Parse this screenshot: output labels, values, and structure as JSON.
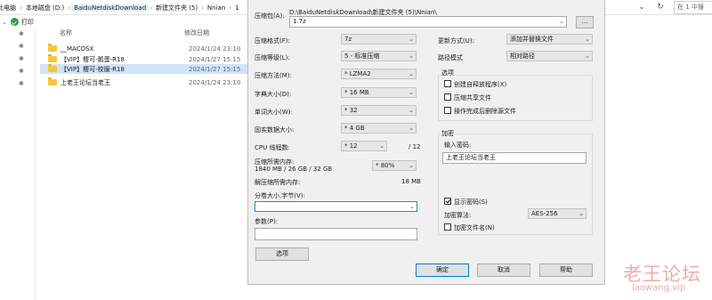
{
  "explorer": {
    "breadcrumb": [
      "此电脑",
      "本地磁盘 (D:)",
      "BaiduNetdiskDownload",
      "新建文件夹 (5)",
      "Nnian",
      "1"
    ],
    "search_placeholder": "在 1 中搜",
    "toolbar_label": "打印",
    "columns": {
      "name": "名称",
      "date": "修改日期"
    },
    "files": [
      {
        "name": "__MACOSX",
        "date": "2024/1/24 23:10",
        "selected": false
      },
      {
        "name": "【VIP】樱可-鹅蛋-R18",
        "date": "2024/1/27 15:15",
        "selected": false
      },
      {
        "name": "【VIP】樱可-校服-R18",
        "date": "2024/1/27 15:15",
        "selected": true
      },
      {
        "name": "上老王论坛当老王",
        "date": "2024/1/24 23:10",
        "selected": false
      }
    ]
  },
  "dialog": {
    "archive_label": "压缩包(A):",
    "archive_path": "D:\\BaiduNetdiskDownload\\新建文件夹 (5)\\Nnian\\",
    "archive_name": "1.7z",
    "browse_label": "...",
    "format_label": "压缩格式(F):",
    "format_value": "7z",
    "level_label": "压缩等级(L):",
    "level_value": "5 - 标准压缩",
    "method_label": "压缩方法(M):",
    "method_value": "* LZMA2",
    "dict_label": "字典大小(D):",
    "dict_value": "* 16 MB",
    "word_label": "单词大小(W):",
    "word_value": "* 32",
    "solid_label": "固实数据大小:",
    "solid_value": "* 4 GB",
    "threads_label": "CPU 线程数:",
    "threads_value": "* 12",
    "threads_max": "/ 12",
    "mem_label": "压缩所需内存:",
    "mem_detail": "1840 MB / 26 GB / 32 GB",
    "mem_value": "* 80%",
    "decomp_label": "解压缩所需内存:",
    "decomp_value": "18 MB",
    "split_label": "分卷大小,字节(V):",
    "split_value": "",
    "params_label": "参数(P):",
    "params_value": "",
    "options_button": "选项",
    "update_label": "更新方式(U):",
    "update_value": "添加并替换文件",
    "pathmode_label": "路径模式",
    "pathmode_value": "相对路径",
    "options_group": "选项",
    "opt_sfx": "创建自释放程序(X)",
    "opt_shared": "压缩共享文件",
    "opt_delete": "操作完成后删除源文件",
    "encrypt_group": "加密",
    "password_label": "输入密码:",
    "password_value": "上老王论坛当老王",
    "show_password": "显示密码(S)",
    "enc_method_label": "加密算法:",
    "enc_method_value": "AES-256",
    "encrypt_names": "加密文件名(N)",
    "ok_button": "确定",
    "cancel_button": "取消",
    "help_button": "帮助"
  },
  "watermark": {
    "cn": "老王论坛",
    "url": "laowang.vip"
  }
}
